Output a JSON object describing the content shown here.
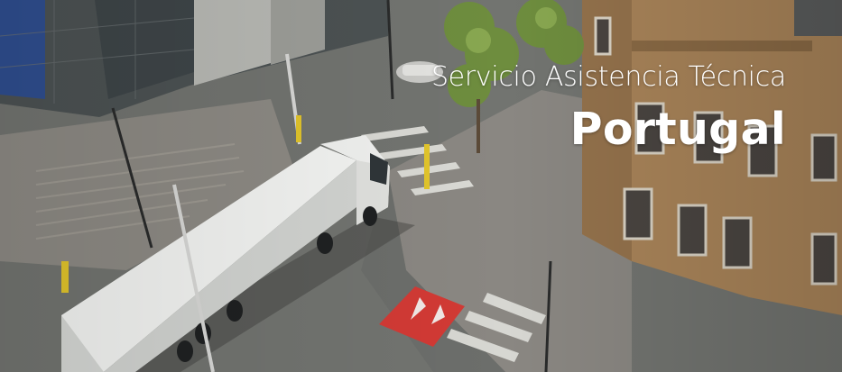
{
  "banner": {
    "subtitle": "Servicio Asistencia Técnica",
    "country": "Portugal"
  },
  "colors": {
    "text": "#ffffff",
    "crosswalk_red": "#d23a35",
    "brick": "#a98459",
    "road": "#6e706d"
  }
}
